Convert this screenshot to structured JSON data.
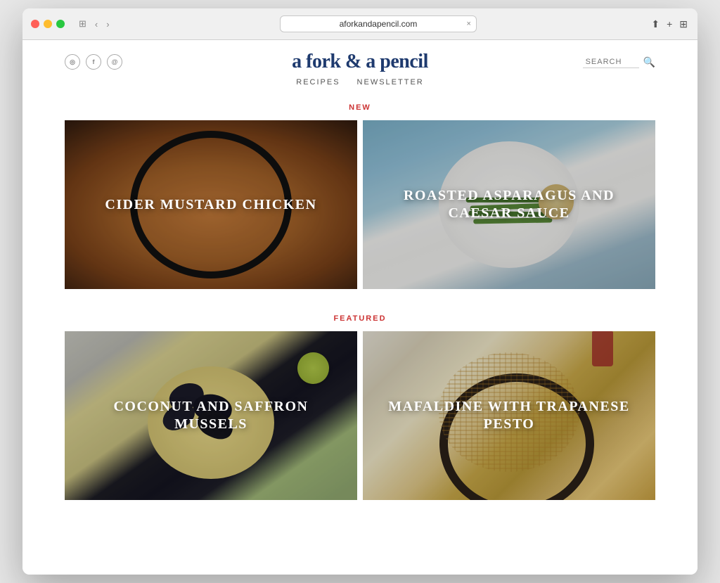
{
  "browser": {
    "url": "aforkandapencil.com",
    "tab_close": "×",
    "back": "‹",
    "forward": "›",
    "sidebar": "⊞"
  },
  "site": {
    "title": "a fork & a pencil",
    "nav": [
      {
        "label": "RECIPES"
      },
      {
        "label": "NEWSLETTER"
      }
    ],
    "search_placeholder": "SEARCH",
    "social": [
      {
        "icon": "rss",
        "label": "rss-icon"
      },
      {
        "icon": "f",
        "label": "facebook-icon"
      },
      {
        "icon": "@",
        "label": "instagram-icon"
      }
    ]
  },
  "sections": [
    {
      "label": "NEW",
      "recipes": [
        {
          "title": "CIDER MUSTARD CHICKEN",
          "theme": "cider-chicken"
        },
        {
          "title": "ROASTED ASPARAGUS AND CAESAR SAUCE",
          "theme": "asparagus"
        }
      ]
    },
    {
      "label": "FEATURED",
      "recipes": [
        {
          "title": "COCONUT AND SAFFRON MUSSELS",
          "theme": "mussels"
        },
        {
          "title": "MAFALDINE WITH TRAPANESE PESTO",
          "theme": "pasta"
        }
      ]
    }
  ]
}
